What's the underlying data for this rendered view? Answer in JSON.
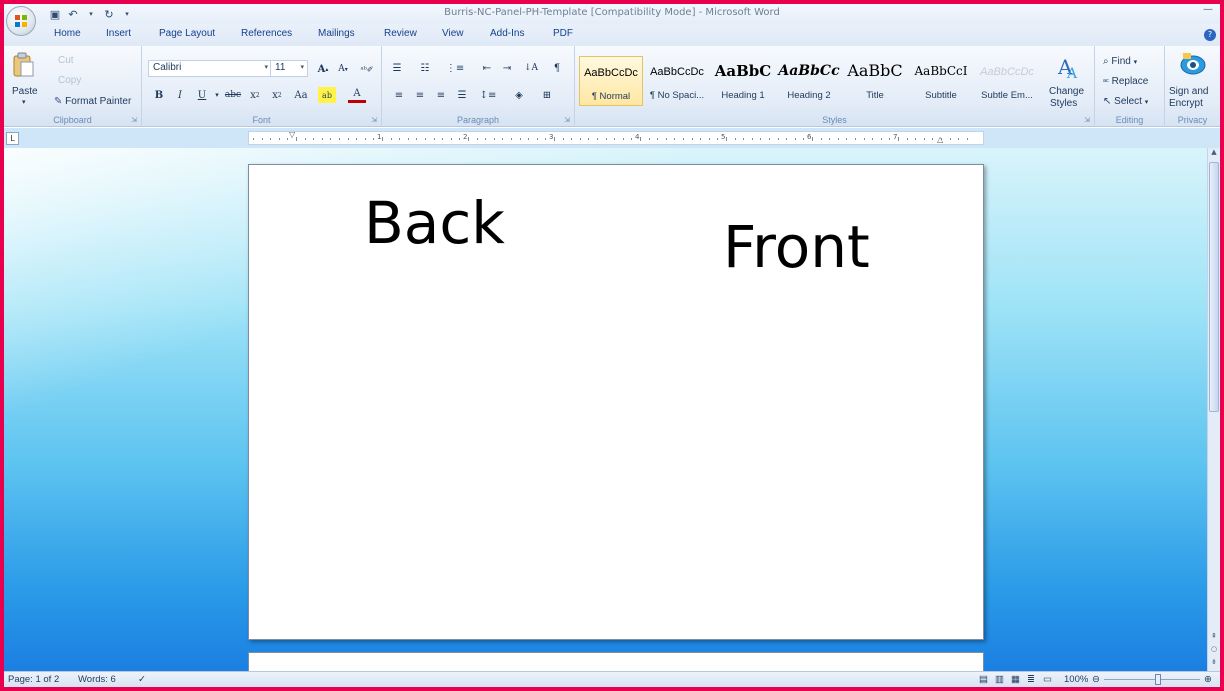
{
  "window": {
    "title": "Burris-NC-Panel-PH-Template [Compatibility Mode] - Microsoft Word"
  },
  "tabs": [
    "Home",
    "Insert",
    "Page Layout",
    "References",
    "Mailings",
    "Review",
    "View",
    "Add-Ins",
    "PDF"
  ],
  "clipboard": {
    "label": "Clipboard",
    "paste": "Paste",
    "cut": "Cut",
    "copy": "Copy",
    "format_painter": "Format Painter"
  },
  "font": {
    "label": "Font",
    "name": "Calibri",
    "size": "11"
  },
  "paragraph": {
    "label": "Paragraph"
  },
  "styles": {
    "label": "Styles",
    "items": [
      {
        "sample": "AaBbCcDc",
        "name": "¶ Normal"
      },
      {
        "sample": "AaBbCcDc",
        "name": "¶ No Spaci..."
      },
      {
        "sample": "AaBbC",
        "name": "Heading 1"
      },
      {
        "sample": "AaBbCc",
        "name": "Heading 2"
      },
      {
        "sample": "AaBbC",
        "name": "Title"
      },
      {
        "sample": "AaBbCcI",
        "name": "Subtitle"
      },
      {
        "sample": "AaBbCcDc",
        "name": "Subtle Em..."
      }
    ],
    "change_styles_1": "Change",
    "change_styles_2": "Styles"
  },
  "editing": {
    "label": "Editing",
    "find": "Find",
    "replace": "Replace",
    "select": "Select"
  },
  "privacy": {
    "label": "Privacy",
    "sign_1": "Sign and",
    "sign_2": "Encrypt"
  },
  "ruler_numbers": [
    "1",
    "2",
    "3",
    "4",
    "5",
    "6",
    "7"
  ],
  "document": {
    "back": "Back",
    "front": "Front"
  },
  "status": {
    "page": "Page: 1 of 2",
    "words": "Words: 6",
    "zoom": "100%"
  },
  "colors": {
    "ribbon_text": "#1e395b",
    "accent_border": "#e8004f"
  }
}
